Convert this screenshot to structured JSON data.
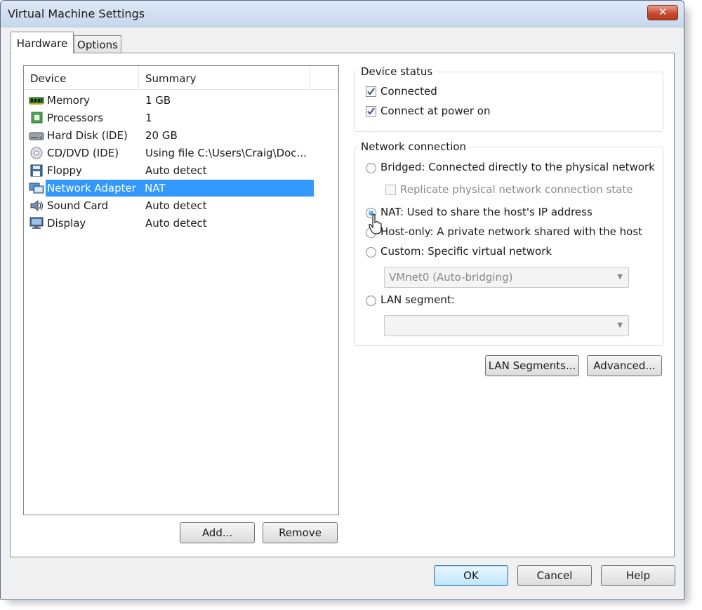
{
  "window": {
    "title": "Virtual Machine Settings",
    "close_glyph": "✕"
  },
  "tabs": [
    {
      "label": "Hardware",
      "active": true
    },
    {
      "label": "Options",
      "active": false
    }
  ],
  "device_list": {
    "columns": [
      "Device",
      "Summary"
    ],
    "rows": [
      {
        "icon": "memory-icon",
        "device": "Memory",
        "summary": "1 GB",
        "selected": false
      },
      {
        "icon": "processor-icon",
        "device": "Processors",
        "summary": "1",
        "selected": false
      },
      {
        "icon": "hard-disk-icon",
        "device": "Hard Disk (IDE)",
        "summary": "20 GB",
        "selected": false
      },
      {
        "icon": "cd-dvd-icon",
        "device": "CD/DVD (IDE)",
        "summary": "Using file C:\\Users\\Craig\\Doc...",
        "selected": false
      },
      {
        "icon": "floppy-icon",
        "device": "Floppy",
        "summary": "Auto detect",
        "selected": false
      },
      {
        "icon": "network-adapter-icon",
        "device": "Network Adapter",
        "summary": "NAT",
        "selected": true
      },
      {
        "icon": "sound-card-icon",
        "device": "Sound Card",
        "summary": "Auto detect",
        "selected": false
      },
      {
        "icon": "display-icon",
        "device": "Display",
        "summary": "Auto detect",
        "selected": false
      }
    ],
    "add_label": "Add...",
    "remove_label": "Remove"
  },
  "device_status": {
    "title": "Device status",
    "connected_label": "Connected",
    "connected_checked": true,
    "power_on_label": "Connect at power on",
    "power_on_checked": true
  },
  "network_connection": {
    "title": "Network connection",
    "bridged_label": "Bridged: Connected directly to the physical network",
    "replicate_label": "Replicate physical network connection state",
    "nat_label": "NAT: Used to share the host's IP address",
    "host_only_label": "Host-only: A private network shared with the host",
    "custom_label": "Custom: Specific virtual network",
    "custom_network_value": "VMnet0 (Auto-bridging)",
    "lan_segment_label": "LAN segment:",
    "lan_segment_value": "",
    "selected": "nat",
    "lan_segments_button": "LAN Segments...",
    "advanced_button": "Advanced..."
  },
  "footer": {
    "ok_label": "OK",
    "cancel_label": "Cancel",
    "help_label": "Help"
  },
  "colors": {
    "selection": "#3399ff",
    "close_button": "#c74b30",
    "titlebar": "#c7d7ec"
  }
}
